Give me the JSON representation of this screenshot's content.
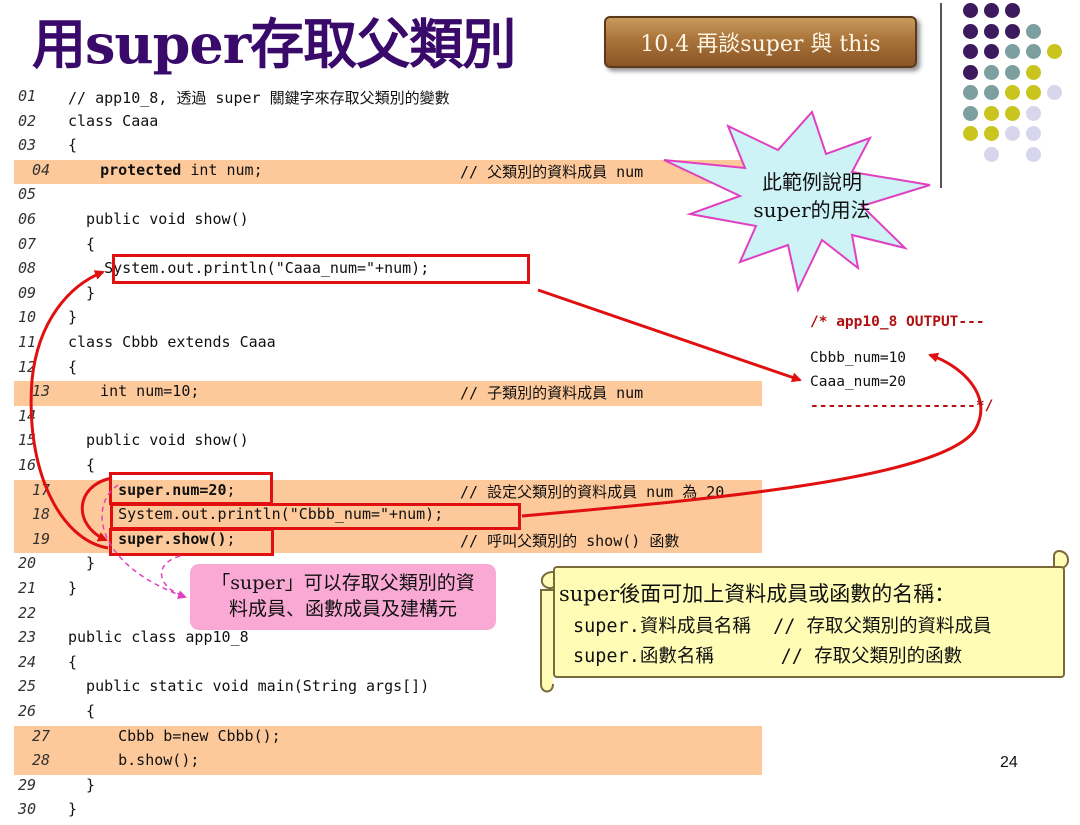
{
  "slide": {
    "title": "用super存取父類別",
    "section_badge": "10.4 再談super 與 this",
    "page_number": "24"
  },
  "code": {
    "lines": [
      {
        "num": "01",
        "text": "// app10_8, 透過 super 關鍵字來存取父類別的變數",
        "comment": "",
        "highlight": false
      },
      {
        "num": "02",
        "text": "class Caaa",
        "comment": "",
        "highlight": false
      },
      {
        "num": "03",
        "text": "{",
        "comment": "",
        "highlight": false
      },
      {
        "num": "04",
        "text": "  protected int num;",
        "comment": "// 父類別的資料成員 num",
        "highlight": true
      },
      {
        "num": "05",
        "text": "",
        "comment": "",
        "highlight": false
      },
      {
        "num": "06",
        "text": "  public void show()",
        "comment": "",
        "highlight": false
      },
      {
        "num": "07",
        "text": "  {",
        "comment": "",
        "highlight": false
      },
      {
        "num": "08",
        "text": "    System.out.println(\"Caaa_num=\"+num);",
        "comment": "",
        "highlight": false
      },
      {
        "num": "09",
        "text": "  }",
        "comment": "",
        "highlight": false
      },
      {
        "num": "10",
        "text": "}",
        "comment": "",
        "highlight": false
      },
      {
        "num": "11",
        "text": "class Cbbb extends Caaa",
        "comment": "",
        "highlight": false
      },
      {
        "num": "12",
        "text": "{",
        "comment": "",
        "highlight": false
      },
      {
        "num": "13",
        "text": "  int num=10;",
        "comment": "// 子類別的資料成員 num",
        "highlight": true
      },
      {
        "num": "14",
        "text": "",
        "comment": "",
        "highlight": false
      },
      {
        "num": "15",
        "text": "  public void show()",
        "comment": "",
        "highlight": false
      },
      {
        "num": "16",
        "text": "  {",
        "comment": "",
        "highlight": false
      },
      {
        "num": "17",
        "text": "    super.num=20;",
        "comment": "// 設定父類別的資料成員 num 為 20",
        "highlight": true
      },
      {
        "num": "18",
        "text": "    System.out.println(\"Cbbb_num=\"+num);",
        "comment": "",
        "highlight": true
      },
      {
        "num": "19",
        "text": "    super.show();",
        "comment": "// 呼叫父類別的 show() 函數",
        "highlight": true
      },
      {
        "num": "20",
        "text": "  }",
        "comment": "",
        "highlight": false
      },
      {
        "num": "21",
        "text": "}",
        "comment": "",
        "highlight": false
      },
      {
        "num": "22",
        "text": "",
        "comment": "",
        "highlight": false
      },
      {
        "num": "23",
        "text": "public class app10_8",
        "comment": "",
        "highlight": false
      },
      {
        "num": "24",
        "text": "{",
        "comment": "",
        "highlight": false
      },
      {
        "num": "25",
        "text": "  public static void main(String args[])",
        "comment": "",
        "highlight": false
      },
      {
        "num": "26",
        "text": "  {",
        "comment": "",
        "highlight": false
      },
      {
        "num": "27",
        "text": "    Cbbb b=new Cbbb();",
        "comment": "",
        "highlight": true
      },
      {
        "num": "28",
        "text": "    b.show();",
        "comment": "",
        "highlight": true
      },
      {
        "num": "29",
        "text": "  }",
        "comment": "",
        "highlight": false
      },
      {
        "num": "30",
        "text": "}",
        "comment": "",
        "highlight": false
      }
    ]
  },
  "output": {
    "header": "/* app10_8 OUTPUT---",
    "line1": "Cbbb_num=10",
    "line2": "Caaa_num=20",
    "footer": "-------------------*/"
  },
  "callouts": {
    "starburst_line1": "此範例說明",
    "starburst_line2": "super的用法",
    "pink_line1": "「super」可以存取父類別的資",
    "pink_line2": "料成員、函數成員及建構元",
    "note_head": "super後面可加上資料成員或函數的名稱：",
    "note_line1": "super.資料成員名稱  // 存取父類別的資料成員",
    "note_line2": "super.函數名稱      // 存取父類別的函數"
  },
  "colors": {
    "title": "#3a0a6b",
    "highlight_row": "#fdc99a",
    "red_box": "#e01010",
    "dot_purple": "#3d1a5e",
    "dot_teal": "#7d9fa0",
    "dot_olive": "#c9c51e",
    "dot_lavender": "#d7d6ec"
  }
}
